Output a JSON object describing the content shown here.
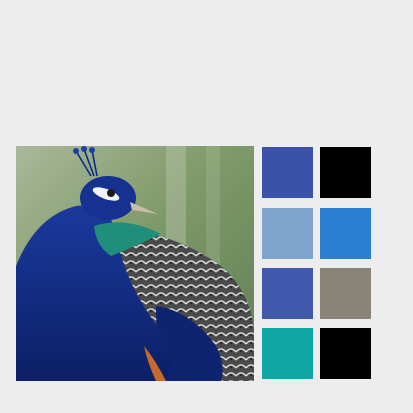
{
  "image": {
    "subject_icon": "peacock-photo"
  },
  "palette": {
    "swatches": [
      {
        "color": "#3a52a8"
      },
      {
        "color": "#000000"
      },
      {
        "color": "#7fa5cf"
      },
      {
        "color": "#2a7fd4"
      },
      {
        "color": "#4159ad"
      },
      {
        "color": "#8a8378"
      },
      {
        "color": "#10a6a6"
      },
      {
        "color": "#000000"
      }
    ]
  }
}
